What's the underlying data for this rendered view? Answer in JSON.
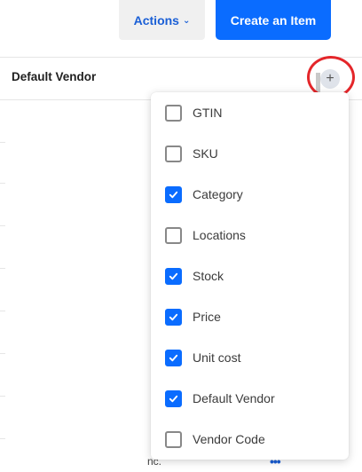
{
  "toolbar": {
    "actions_label": "Actions",
    "create_label": "Create an Item"
  },
  "table": {
    "column_header": "Default Vendor",
    "add_column_symbol": "+",
    "partial_text_bottom": "nc.",
    "row_menu_symbol": "•••"
  },
  "column_menu": {
    "options": [
      {
        "label": "GTIN",
        "checked": false
      },
      {
        "label": "SKU",
        "checked": false
      },
      {
        "label": "Category",
        "checked": true
      },
      {
        "label": "Locations",
        "checked": false
      },
      {
        "label": "Stock",
        "checked": true
      },
      {
        "label": "Price",
        "checked": true
      },
      {
        "label": "Unit cost",
        "checked": true
      },
      {
        "label": "Default Vendor",
        "checked": true
      },
      {
        "label": "Vendor Code",
        "checked": false
      }
    ]
  },
  "colors": {
    "primary": "#0a6cff",
    "accent_text": "#1a5fd6",
    "highlight_circle": "#e4262a"
  }
}
